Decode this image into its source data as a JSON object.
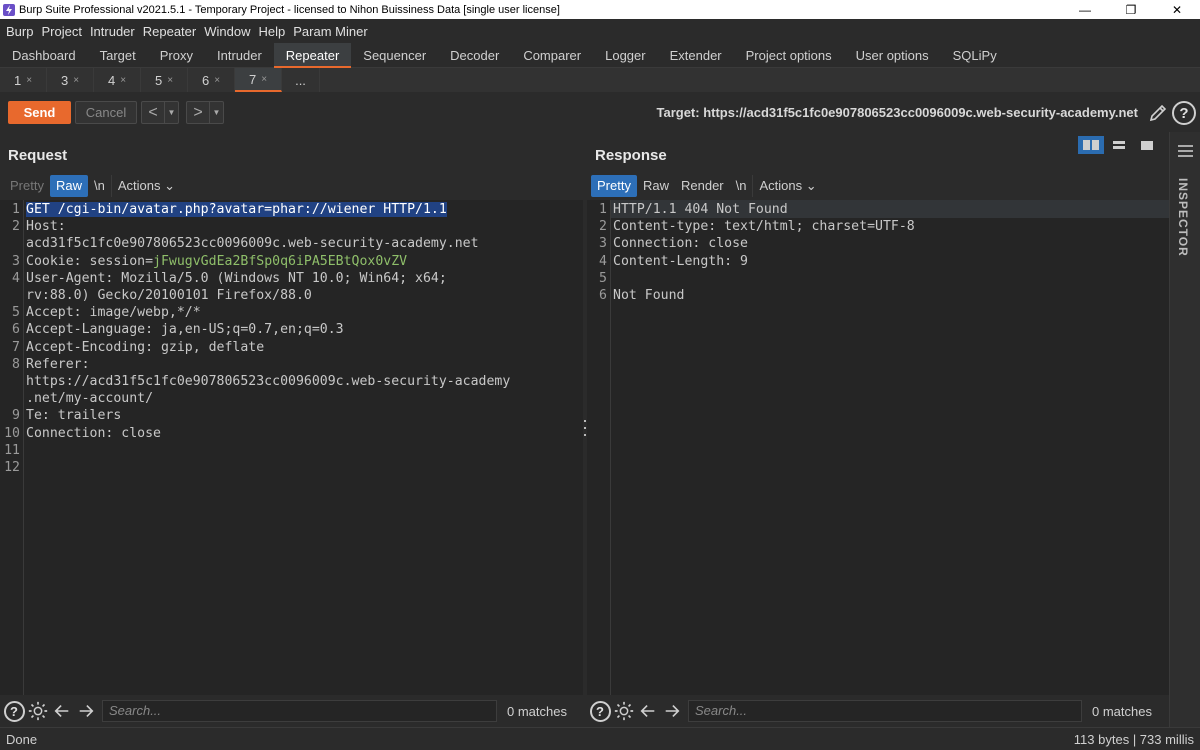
{
  "window": {
    "title": "Burp Suite Professional v2021.5.1 - Temporary Project - licensed to Nihon Buissiness Data [single user license]",
    "minimize": "—",
    "restore": "❐",
    "close": "✕"
  },
  "menu": [
    "Burp",
    "Project",
    "Intruder",
    "Repeater",
    "Window",
    "Help",
    "Param Miner"
  ],
  "main_tabs": [
    "Dashboard",
    "Target",
    "Proxy",
    "Intruder",
    "Repeater",
    "Sequencer",
    "Decoder",
    "Comparer",
    "Logger",
    "Extender",
    "Project options",
    "User options",
    "SQLiPy"
  ],
  "active_main_tab": "Repeater",
  "sub_tabs": [
    {
      "label": "1",
      "close": "×"
    },
    {
      "label": "3",
      "close": "×"
    },
    {
      "label": "4",
      "close": "×"
    },
    {
      "label": "5",
      "close": "×"
    },
    {
      "label": "6",
      "close": "×"
    },
    {
      "label": "7",
      "close": "×"
    }
  ],
  "sub_tab_more": "...",
  "toolbar": {
    "send": "Send",
    "cancel": "Cancel",
    "back": "<",
    "forward": ">",
    "dropdown": "▼",
    "target": "Target: https://acd31f5c1fc0e907806523cc0096009c.web-security-academy.net",
    "help": "?"
  },
  "request": {
    "title": "Request",
    "modes": [
      "Pretty",
      "Raw",
      "\\n"
    ],
    "active_mode": "Raw",
    "actions": "Actions",
    "line_numbers": [
      "1",
      "2",
      "",
      "3",
      "4",
      "",
      "5",
      "6",
      "7",
      "8",
      "",
      "",
      "9",
      "10",
      "11",
      "12"
    ],
    "lines": [
      {
        "parts": [
          {
            "t": "GET /cgi-bin/avatar.php?avatar=",
            "c": "hl"
          },
          {
            "t": "phar://wiener",
            "c": "hl"
          },
          {
            "t": " HTTP/1.1",
            "c": "hl"
          }
        ]
      },
      {
        "parts": [
          {
            "t": "Host:",
            "c": "key"
          }
        ]
      },
      {
        "parts": [
          {
            "t": "acd31f5c1fc0e907806523cc0096009c.web-security-academy.net",
            "c": "key"
          }
        ]
      },
      {
        "parts": [
          {
            "t": "Cookie: session=",
            "c": "key"
          },
          {
            "t": "jFwugvGdEa2BfSp0q6iPA5EBtQox0vZV",
            "c": "val"
          }
        ]
      },
      {
        "parts": [
          {
            "t": "User-Agent: Mozilla/5.0 (Windows NT 10.0; Win64; x64;",
            "c": "key"
          }
        ]
      },
      {
        "parts": [
          {
            "t": "rv:88.0) Gecko/20100101 Firefox/88.0",
            "c": "key"
          }
        ]
      },
      {
        "parts": [
          {
            "t": "Accept: image/webp,*/*",
            "c": "key"
          }
        ]
      },
      {
        "parts": [
          {
            "t": "Accept-Language: ja,en-US;q=0.7,en;q=0.3",
            "c": "key"
          }
        ]
      },
      {
        "parts": [
          {
            "t": "Accept-Encoding: gzip, deflate",
            "c": "key"
          }
        ]
      },
      {
        "parts": [
          {
            "t": "Referer:",
            "c": "key"
          }
        ]
      },
      {
        "parts": [
          {
            "t": "https://acd31f5c1fc0e907806523cc0096009c.web-security-academy",
            "c": "key"
          }
        ]
      },
      {
        "parts": [
          {
            "t": ".net/my-account/",
            "c": "key"
          }
        ]
      },
      {
        "parts": [
          {
            "t": "Te: trailers",
            "c": "key"
          }
        ]
      },
      {
        "parts": [
          {
            "t": "Connection: close",
            "c": "key"
          }
        ]
      },
      {
        "parts": [
          {
            "t": "",
            "c": "key"
          }
        ]
      },
      {
        "parts": [
          {
            "t": "",
            "c": "key"
          }
        ]
      }
    ],
    "search_placeholder": "Search...",
    "matches": "0 matches"
  },
  "response": {
    "title": "Response",
    "modes": [
      "Pretty",
      "Raw",
      "Render",
      "\\n"
    ],
    "active_mode": "Pretty",
    "actions": "Actions",
    "line_numbers": [
      "1",
      "2",
      "3",
      "4",
      "5",
      "6"
    ],
    "lines": [
      "HTTP/1.1 404 Not Found",
      "Content-type: text/html; charset=UTF-8",
      "Connection: close",
      "Content-Length: 9",
      "",
      "Not Found"
    ],
    "search_placeholder": "Search...",
    "matches": "0 matches"
  },
  "inspector": {
    "label": "INSPECTOR"
  },
  "status": {
    "left": "Done",
    "right": "113 bytes | 733 millis"
  },
  "colors": {
    "accent": "#e8692d",
    "selected_mode": "#2d6fb8",
    "background": "#2b2b2b"
  }
}
